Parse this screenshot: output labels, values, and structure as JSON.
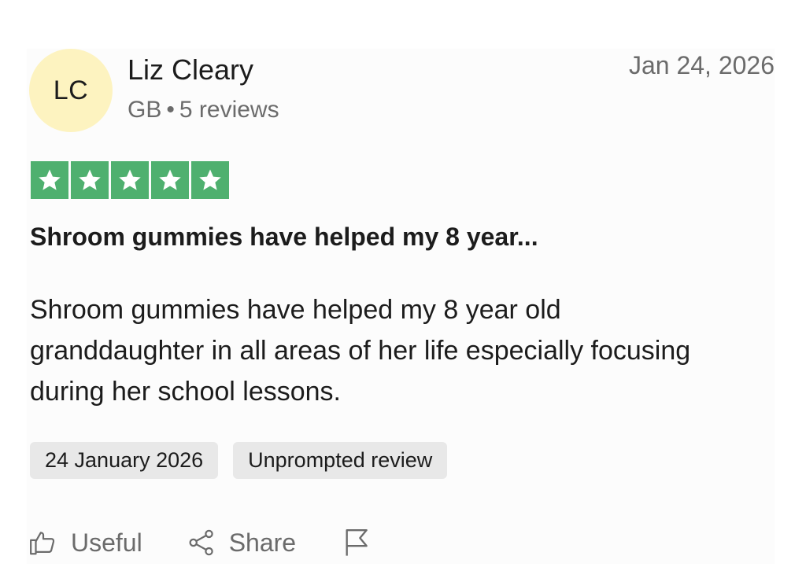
{
  "reviewer": {
    "initials": "LC",
    "name": "Liz Cleary",
    "country": "GB",
    "separator": "•",
    "review_count": "5 reviews",
    "avatar_color": "#fdf3c0"
  },
  "review": {
    "date_short": "Jan 24, 2026",
    "rating": 5,
    "rating_max": 5,
    "star_color": "#4fb06f",
    "title": "Shroom gummies have helped my 8 year...",
    "text": "Shroom gummies have helped my 8 year old granddaughter in all areas of her life especially focusing during her school lessons.",
    "tags": [
      "24 January 2026",
      "Unprompted review"
    ]
  },
  "actions": {
    "useful_label": "Useful",
    "useful_icon": "thumbs-up-icon",
    "share_label": "Share",
    "share_icon": "share-icon",
    "flag_icon": "flag-icon"
  }
}
